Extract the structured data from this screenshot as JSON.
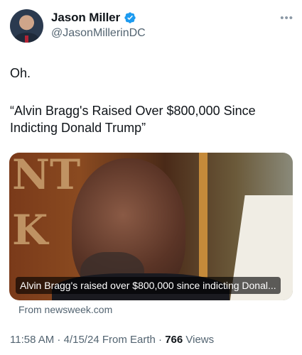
{
  "author": {
    "name": "Jason Miller",
    "handle": "@JasonMillerinDC"
  },
  "more_label": "•••",
  "body": {
    "line1": "Oh.",
    "quote": "“Alvin Bragg's Raised Over $800,000 Since Indicting Donald Trump”"
  },
  "card": {
    "background_letters": "NT\nK",
    "caption": "Alvin Bragg's raised over $800,000 since indicting Donal...",
    "source": "From newsweek.com"
  },
  "meta": {
    "time": "11:58 AM",
    "dot1": " · ",
    "date": "4/15/24",
    "client": " From Earth",
    "dot2": " · ",
    "views_count": "766",
    "views_label": " Views"
  },
  "colors": {
    "verified": "#1d9bf0",
    "secondary_text": "#536471"
  }
}
